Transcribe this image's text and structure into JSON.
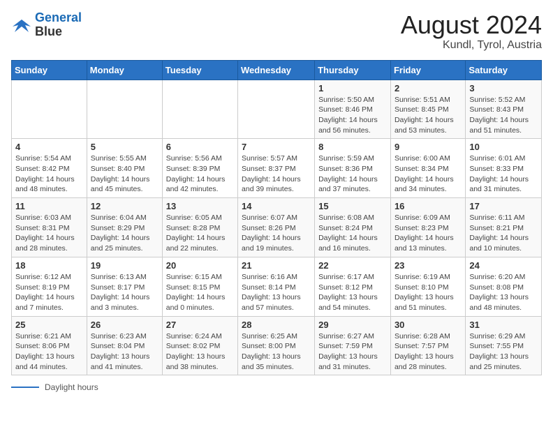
{
  "header": {
    "logo_line1": "General",
    "logo_line2": "Blue",
    "title": "August 2024",
    "subtitle": "Kundl, Tyrol, Austria"
  },
  "calendar": {
    "days_of_week": [
      "Sunday",
      "Monday",
      "Tuesday",
      "Wednesday",
      "Thursday",
      "Friday",
      "Saturday"
    ],
    "weeks": [
      [
        {
          "day": "",
          "info": ""
        },
        {
          "day": "",
          "info": ""
        },
        {
          "day": "",
          "info": ""
        },
        {
          "day": "",
          "info": ""
        },
        {
          "day": "1",
          "info": "Sunrise: 5:50 AM\nSunset: 8:46 PM\nDaylight: 14 hours and 56 minutes."
        },
        {
          "day": "2",
          "info": "Sunrise: 5:51 AM\nSunset: 8:45 PM\nDaylight: 14 hours and 53 minutes."
        },
        {
          "day": "3",
          "info": "Sunrise: 5:52 AM\nSunset: 8:43 PM\nDaylight: 14 hours and 51 minutes."
        }
      ],
      [
        {
          "day": "4",
          "info": "Sunrise: 5:54 AM\nSunset: 8:42 PM\nDaylight: 14 hours and 48 minutes."
        },
        {
          "day": "5",
          "info": "Sunrise: 5:55 AM\nSunset: 8:40 PM\nDaylight: 14 hours and 45 minutes."
        },
        {
          "day": "6",
          "info": "Sunrise: 5:56 AM\nSunset: 8:39 PM\nDaylight: 14 hours and 42 minutes."
        },
        {
          "day": "7",
          "info": "Sunrise: 5:57 AM\nSunset: 8:37 PM\nDaylight: 14 hours and 39 minutes."
        },
        {
          "day": "8",
          "info": "Sunrise: 5:59 AM\nSunset: 8:36 PM\nDaylight: 14 hours and 37 minutes."
        },
        {
          "day": "9",
          "info": "Sunrise: 6:00 AM\nSunset: 8:34 PM\nDaylight: 14 hours and 34 minutes."
        },
        {
          "day": "10",
          "info": "Sunrise: 6:01 AM\nSunset: 8:33 PM\nDaylight: 14 hours and 31 minutes."
        }
      ],
      [
        {
          "day": "11",
          "info": "Sunrise: 6:03 AM\nSunset: 8:31 PM\nDaylight: 14 hours and 28 minutes."
        },
        {
          "day": "12",
          "info": "Sunrise: 6:04 AM\nSunset: 8:29 PM\nDaylight: 14 hours and 25 minutes."
        },
        {
          "day": "13",
          "info": "Sunrise: 6:05 AM\nSunset: 8:28 PM\nDaylight: 14 hours and 22 minutes."
        },
        {
          "day": "14",
          "info": "Sunrise: 6:07 AM\nSunset: 8:26 PM\nDaylight: 14 hours and 19 minutes."
        },
        {
          "day": "15",
          "info": "Sunrise: 6:08 AM\nSunset: 8:24 PM\nDaylight: 14 hours and 16 minutes."
        },
        {
          "day": "16",
          "info": "Sunrise: 6:09 AM\nSunset: 8:23 PM\nDaylight: 14 hours and 13 minutes."
        },
        {
          "day": "17",
          "info": "Sunrise: 6:11 AM\nSunset: 8:21 PM\nDaylight: 14 hours and 10 minutes."
        }
      ],
      [
        {
          "day": "18",
          "info": "Sunrise: 6:12 AM\nSunset: 8:19 PM\nDaylight: 14 hours and 7 minutes."
        },
        {
          "day": "19",
          "info": "Sunrise: 6:13 AM\nSunset: 8:17 PM\nDaylight: 14 hours and 3 minutes."
        },
        {
          "day": "20",
          "info": "Sunrise: 6:15 AM\nSunset: 8:15 PM\nDaylight: 14 hours and 0 minutes."
        },
        {
          "day": "21",
          "info": "Sunrise: 6:16 AM\nSunset: 8:14 PM\nDaylight: 13 hours and 57 minutes."
        },
        {
          "day": "22",
          "info": "Sunrise: 6:17 AM\nSunset: 8:12 PM\nDaylight: 13 hours and 54 minutes."
        },
        {
          "day": "23",
          "info": "Sunrise: 6:19 AM\nSunset: 8:10 PM\nDaylight: 13 hours and 51 minutes."
        },
        {
          "day": "24",
          "info": "Sunrise: 6:20 AM\nSunset: 8:08 PM\nDaylight: 13 hours and 48 minutes."
        }
      ],
      [
        {
          "day": "25",
          "info": "Sunrise: 6:21 AM\nSunset: 8:06 PM\nDaylight: 13 hours and 44 minutes."
        },
        {
          "day": "26",
          "info": "Sunrise: 6:23 AM\nSunset: 8:04 PM\nDaylight: 13 hours and 41 minutes."
        },
        {
          "day": "27",
          "info": "Sunrise: 6:24 AM\nSunset: 8:02 PM\nDaylight: 13 hours and 38 minutes."
        },
        {
          "day": "28",
          "info": "Sunrise: 6:25 AM\nSunset: 8:00 PM\nDaylight: 13 hours and 35 minutes."
        },
        {
          "day": "29",
          "info": "Sunrise: 6:27 AM\nSunset: 7:59 PM\nDaylight: 13 hours and 31 minutes."
        },
        {
          "day": "30",
          "info": "Sunrise: 6:28 AM\nSunset: 7:57 PM\nDaylight: 13 hours and 28 minutes."
        },
        {
          "day": "31",
          "info": "Sunrise: 6:29 AM\nSunset: 7:55 PM\nDaylight: 13 hours and 25 minutes."
        }
      ]
    ]
  },
  "footer": {
    "label": "Daylight hours"
  }
}
